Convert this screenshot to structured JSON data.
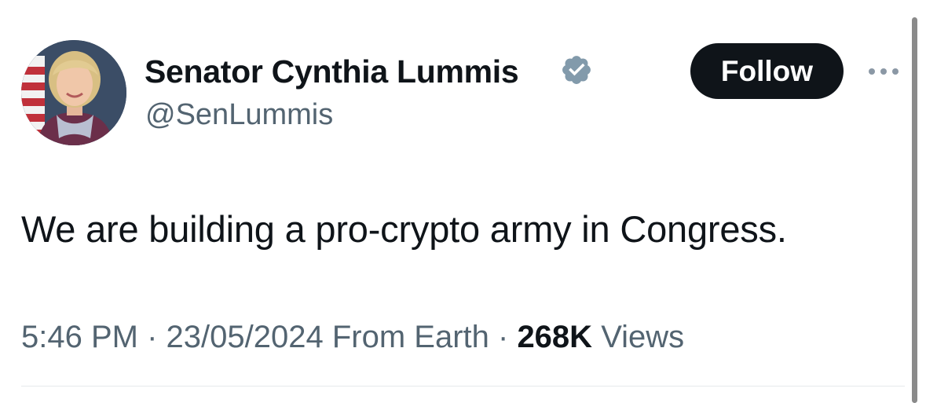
{
  "author": {
    "display_name": "Senator Cynthia Lummis",
    "handle": "@SenLummis",
    "verified_icon": "verified-badge-icon",
    "verified_color": "#829aab"
  },
  "actions": {
    "follow_label": "Follow",
    "more_icon": "more-horizontal-icon"
  },
  "tweet": {
    "text": "We are building a pro-crypto army in Congress.",
    "time": "5:46 PM",
    "separator": " · ",
    "date": "23/05/2024",
    "source": "From Earth",
    "views_count": "268K",
    "views_label": "Views"
  },
  "colors": {
    "text_primary": "#0f1419",
    "text_secondary": "#536471",
    "follow_bg": "#0f1419",
    "follow_text": "#ffffff"
  }
}
